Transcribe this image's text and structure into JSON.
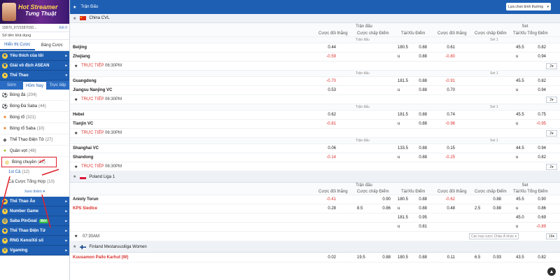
{
  "sidebar": {
    "banner": {
      "title": "Hot Streamer",
      "subtitle": "Tưng Thuật"
    },
    "account": {
      "id": "15870_972158703D...",
      "label": "Kết 0"
    },
    "balance_label": "Số tiền khả dụng",
    "view_tabs": [
      "Hiển thị Cược",
      "Bảng Cược"
    ],
    "favorites": "Yêu thích của tôi",
    "asean": "Giải vô địch ASEAN",
    "sports_header": "Thể Thao",
    "sub_tabs": [
      "Sớm",
      "Hôm Nay",
      "Trực tiếp"
    ],
    "sports": [
      {
        "name": "Bóng đá",
        "count": "(204)",
        "color": "#333"
      },
      {
        "name": "Bóng Đá Saba",
        "count": "(44)",
        "color": "#d8322e"
      },
      {
        "name": "Bóng rổ",
        "count": "(321)",
        "color": "#e97d23"
      },
      {
        "name": "Bóng rổ Saba",
        "count": "(10)",
        "color": "#e97d23"
      },
      {
        "name": "Thể Thao Điện Tử",
        "count": "(27)",
        "color": "#666"
      },
      {
        "name": "Quần vợt",
        "count": "(49)",
        "color": "#9cc233"
      },
      {
        "name": "Bóng chuyền",
        "count": "(12)",
        "color": "#e6b822"
      }
    ],
    "volley_sub": [
      {
        "name": "1st Cả",
        "count": "(12)"
      },
      {
        "name": "Cá Cược Tổng Hợp",
        "count": "(10)"
      }
    ],
    "more": "Xem thêm",
    "bottom_nav": [
      {
        "label": "Thể Thao Ảo",
        "badge": ""
      },
      {
        "label": "Number Game",
        "badge": ""
      },
      {
        "label": "Saba PinGoal",
        "badge": "Mới"
      },
      {
        "label": "Thể Thao Điện Tử",
        "badge": ""
      },
      {
        "label": "RNG Keno/Xổ số",
        "badge": ""
      },
      {
        "label": "Vgaming",
        "badge": ""
      }
    ]
  },
  "main": {
    "header": "Trận Đấu",
    "sort_select": "Lựa chọn bình thường",
    "col_labels": {
      "match": "Trận đấu",
      "set": "Set",
      "set1": "Set 1",
      "win": "Cược đối thắng",
      "hcp": "Cược chấp Điểm",
      "ou": "Tài/Xỉu Điểm",
      "tot": "Tài/Xỉu Tổng Điểm",
      "live": "TRỰC TIẾP",
      "u": "u"
    },
    "china": {
      "name": "China CVL",
      "matches": [
        {
          "home": "Beijing",
          "away": "Zhejiang",
          "w1": "0.44",
          "w2": "-0.59",
          "ou_line": "180.5",
          "ou1": "0.88",
          "ou2": "0.88",
          "s_w1": "0.61",
          "s_w2": "-0.80",
          "t_line": "45.5",
          "t1": "0.82",
          "t2": "0.94",
          "time": "06:30PM",
          "pages": "2"
        },
        {
          "home": "Guangdong",
          "away": "Jiangsu Nanjing VC",
          "w1": "-0.70",
          "w2": "0.53",
          "ou_line": "181.5",
          "ou1": "0.88",
          "ou2": "0.88",
          "s_w1": "-0.91",
          "s_w2": "0.70",
          "t_line": "45.5",
          "t1": "0.82",
          "t2": "0.94",
          "time": "06:30PM",
          "pages": "2"
        },
        {
          "home": "Hebei",
          "away": "Tianjin VC",
          "w1": "0.62",
          "w2": "-0.81",
          "ou_line": "181.5",
          "ou1": "0.88",
          "ou2": "0.88",
          "s_w1": "0.74",
          "s_w2": "-0.96",
          "t_line": "45.5",
          "t1": "0.75",
          "t2": "-0.95",
          "time": "06:30PM",
          "pages": "2"
        },
        {
          "home": "Shanghai VC",
          "away": "Shandong",
          "w1": "0.06",
          "w2": "-0.14",
          "ou_line": "133.5",
          "ou1": "0.88",
          "ou2": "0.88",
          "s_w1": "0.15",
          "s_w2": "-0.25",
          "t_line": "44.5",
          "t1": "0.94",
          "t2": "0.82",
          "time": "06:30PM",
          "pages": "2"
        }
      ]
    },
    "poland": {
      "name": "Poland Liga 1",
      "home": "Anioly Torun",
      "away": "KPS Siedlce",
      "w1": "-0.41",
      "w2": "0.28",
      "h1": "0.90",
      "h_line": "8.5",
      "h2": "0.86",
      "ou_line": "180.5",
      "ou1": "0.88",
      "ou2": "0.88",
      "s_w1": "-0.62",
      "s_w2": "0.48",
      "s_h1": "0.88",
      "s_h_line": "2.5",
      "s_h2": "0.88",
      "t_line": "45.5",
      "t1": "0.90",
      "t2": "0.86",
      "extra1": {
        "ou_line": "181.5",
        "ou1": "0.95",
        "ou2": "0.81",
        "t_line": "45.0",
        "t1": "0.69",
        "t2": "-0.89"
      },
      "time": "07:30AM",
      "more_select": "Các loại cược Châu Á khác",
      "pages": "16"
    },
    "finland": {
      "name": "Finland Mestaruusliiga Women",
      "home": "Kuusamon Pallo Karhut (W)",
      "w1": "0.02",
      "h_line": "19.5",
      "h1": "0.88",
      "ou_line": "180.5",
      "ou1": "0.88",
      "s_w1": "0.11",
      "s_h_line": "6.5",
      "s_h1": "0.93",
      "t_line": "43.5",
      "t1": "0.82"
    }
  },
  "colors": {
    "primary": "#1e5fb4",
    "negative": "#d8322e",
    "highlight": "#e3202a"
  }
}
